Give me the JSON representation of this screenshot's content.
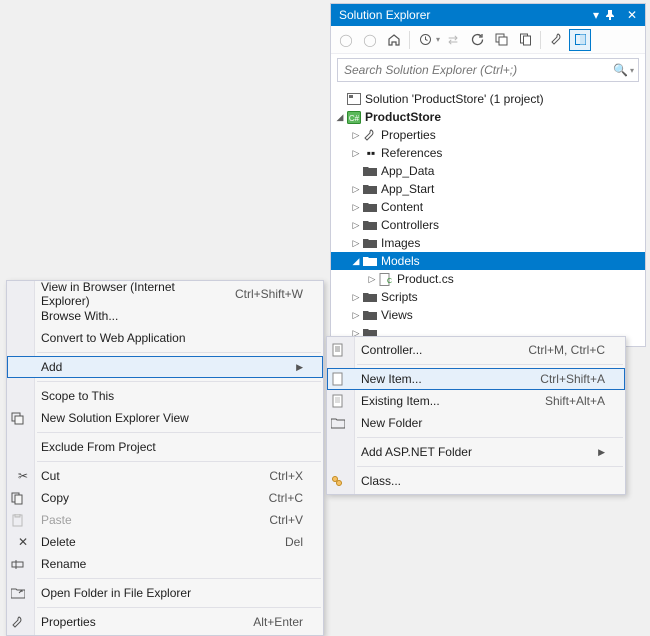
{
  "panel": {
    "title": "Solution Explorer",
    "search_placeholder": "Search Solution Explorer (Ctrl+;)"
  },
  "tree": {
    "solution": "Solution 'ProductStore' (1 project)",
    "project": "ProductStore",
    "nodes": [
      "Properties",
      "References",
      "App_Data",
      "App_Start",
      "Content",
      "Controllers",
      "Images",
      "Models",
      "Scripts",
      "Views"
    ],
    "models_child": "Product.cs"
  },
  "ctx": {
    "view_browser": "View in Browser (Internet Explorer)",
    "view_browser_k": "Ctrl+Shift+W",
    "browse_with": "Browse With...",
    "convert": "Convert to Web Application",
    "add": "Add",
    "scope": "Scope to This",
    "new_view": "New Solution Explorer View",
    "exclude": "Exclude From Project",
    "cut": "Cut",
    "cut_k": "Ctrl+X",
    "copy": "Copy",
    "copy_k": "Ctrl+C",
    "paste": "Paste",
    "paste_k": "Ctrl+V",
    "delete": "Delete",
    "delete_k": "Del",
    "rename": "Rename",
    "open_folder": "Open Folder in File Explorer",
    "properties": "Properties",
    "properties_k": "Alt+Enter"
  },
  "sub": {
    "controller": "Controller...",
    "controller_k": "Ctrl+M, Ctrl+C",
    "new_item": "New Item...",
    "new_item_k": "Ctrl+Shift+A",
    "existing": "Existing Item...",
    "existing_k": "Shift+Alt+A",
    "new_folder": "New Folder",
    "aspnet_folder": "Add ASP.NET Folder",
    "class": "Class..."
  }
}
